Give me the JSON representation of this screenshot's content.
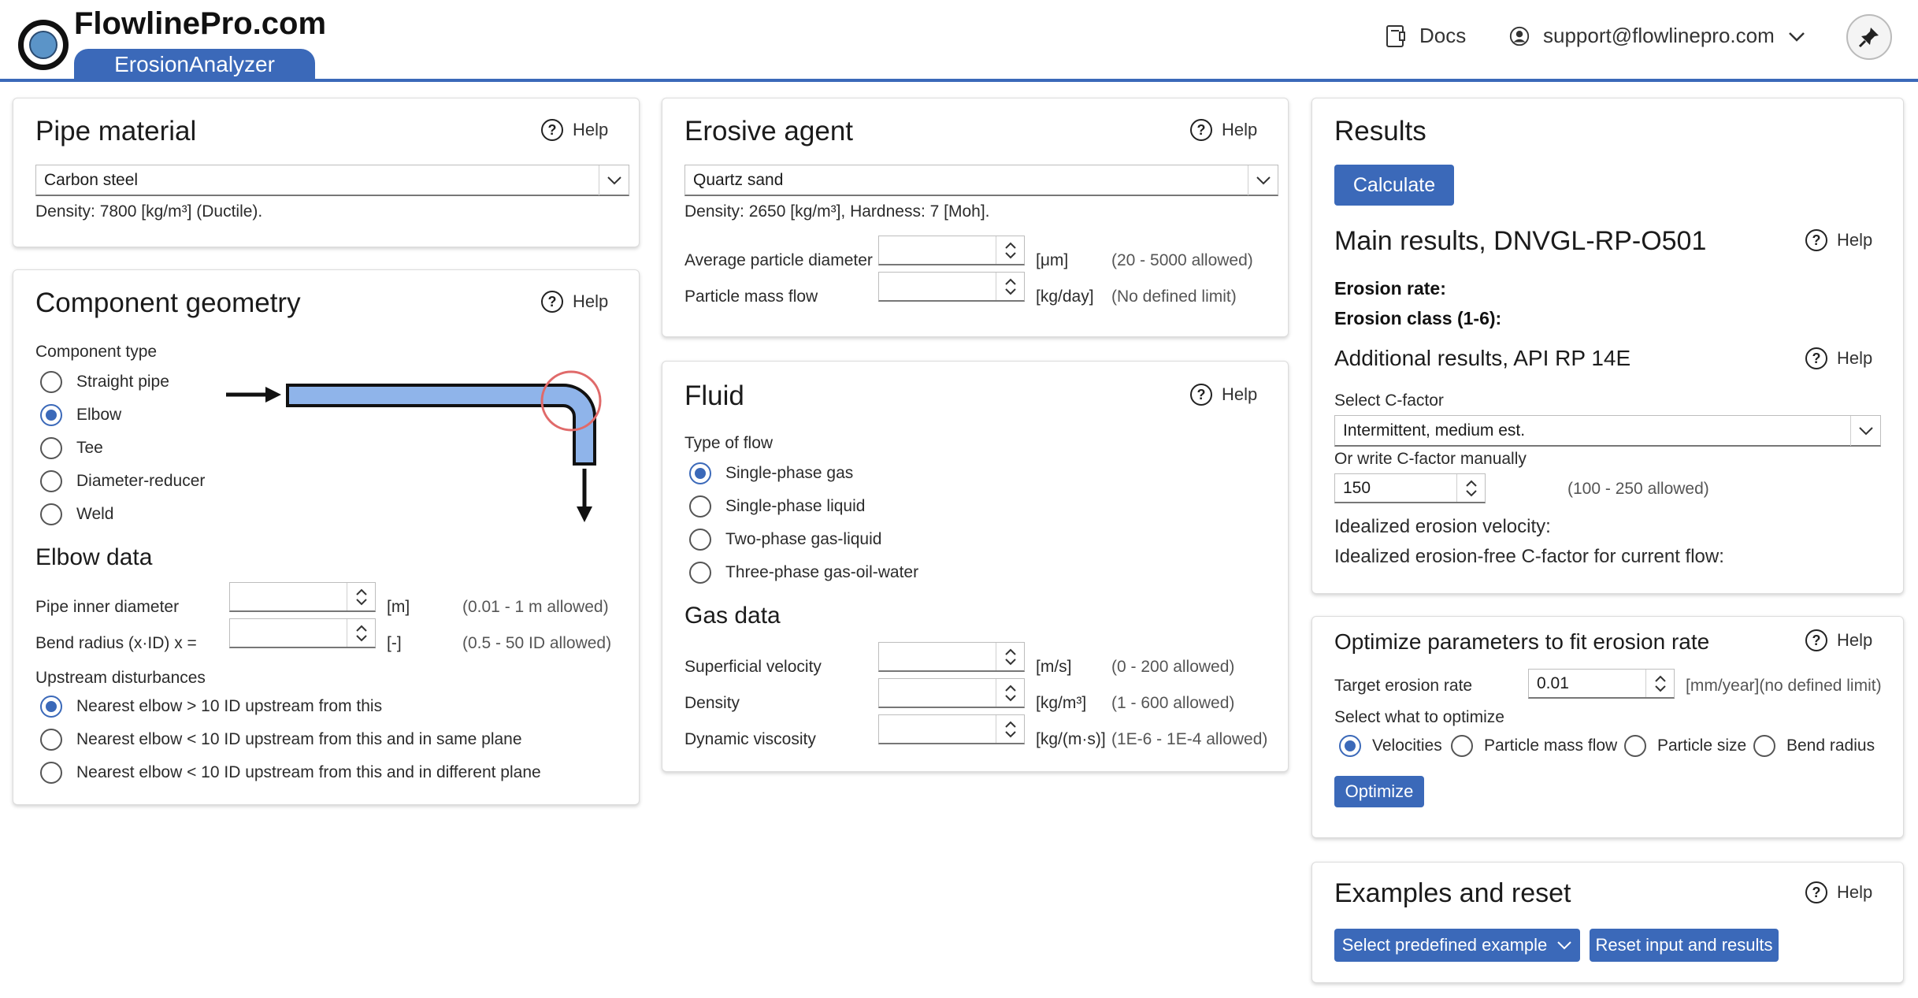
{
  "header": {
    "brand": "FlowlinePro.com",
    "product": "ErosionAnalyzer",
    "docs_label": "Docs",
    "account_email": "support@flowlinepro.com"
  },
  "colors": {
    "accent": "#3b69b9",
    "pipe_fill": "#8fb4ea",
    "highlight_circle": "#e06a6a"
  },
  "pipe_material": {
    "title": "Pipe material",
    "help": "Help",
    "selected": "Carbon steel",
    "info": "Density: 7800 [kg/m³] (Ductile)."
  },
  "geometry": {
    "title": "Component geometry",
    "help": "Help",
    "type_label": "Component type",
    "types": [
      "Straight pipe",
      "Elbow",
      "Tee",
      "Diameter-reducer",
      "Weld"
    ],
    "selected_type": "Elbow",
    "elbow_title": "Elbow data",
    "diameter_label": "Pipe inner diameter",
    "diameter_unit": "[m]",
    "diameter_range": "(0.01 - 1 m allowed)",
    "bend_label": "Bend radius (x·ID) x =",
    "bend_unit": "[-]",
    "bend_range": "(0.5 - 50 ID allowed)",
    "upstream_label": "Upstream disturbances",
    "upstream_options": [
      "Nearest elbow > 10 ID upstream from this",
      "Nearest elbow < 10 ID upstream from this and in same plane",
      "Nearest elbow < 10 ID upstream from this and in different plane"
    ]
  },
  "erosive_agent": {
    "title": "Erosive agent",
    "help": "Help",
    "selected": "Quartz sand",
    "info": "Density: 2650 [kg/m³], Hardness: 7 [Moh].",
    "diameter_label": "Average particle diameter",
    "diameter_unit": "[μm]",
    "diameter_range": "(20 - 5000 allowed)",
    "massflow_label": "Particle mass flow",
    "massflow_unit": "[kg/day]",
    "massflow_range": "(No defined limit)"
  },
  "fluid": {
    "title": "Fluid",
    "help": "Help",
    "flow_label": "Type of flow",
    "flow_types": [
      "Single-phase gas",
      "Single-phase liquid",
      "Two-phase gas-liquid",
      "Three-phase gas-oil-water"
    ],
    "gas_title": "Gas data",
    "velocity_label": "Superficial velocity",
    "velocity_unit": "[m/s]",
    "velocity_range": "(0 - 200 allowed)",
    "density_label": "Density",
    "density_unit": "[kg/m³]",
    "density_range": "(1 - 600 allowed)",
    "viscosity_label": "Dynamic viscosity",
    "viscosity_unit": "[kg/(m·s)]",
    "viscosity_range": "(1E-6 - 1E-4 allowed)"
  },
  "results": {
    "title": "Results",
    "calculate": "Calculate",
    "main_title": "Main results, DNVGL-RP-O501",
    "help": "Help",
    "erosion_rate": "Erosion rate:",
    "erosion_class": "Erosion class (1-6):",
    "additional_title": "Additional results, API RP 14E",
    "cfactor_label": "Select C-factor",
    "cfactor_selected": "Intermittent, medium est.",
    "manual_label": "Or write C-factor manually",
    "manual_value": "150",
    "manual_range": "(100 - 250 allowed)",
    "velocity_line": "Idealized erosion velocity:",
    "cfree_line": "Idealized erosion-free C-factor for current flow:"
  },
  "optimize": {
    "title": "Optimize parameters to fit erosion rate",
    "help": "Help",
    "target_label": "Target erosion rate",
    "target_value": "0.01",
    "target_unit": "[mm/year](no defined limit)",
    "select_label": "Select what to optimize",
    "options": [
      "Velocities",
      "Particle mass flow",
      "Particle size",
      "Bend radius"
    ],
    "button": "Optimize"
  },
  "examples": {
    "title": "Examples and reset",
    "help": "Help",
    "select_button": "Select predefined example",
    "reset_button": "Reset input and results"
  }
}
